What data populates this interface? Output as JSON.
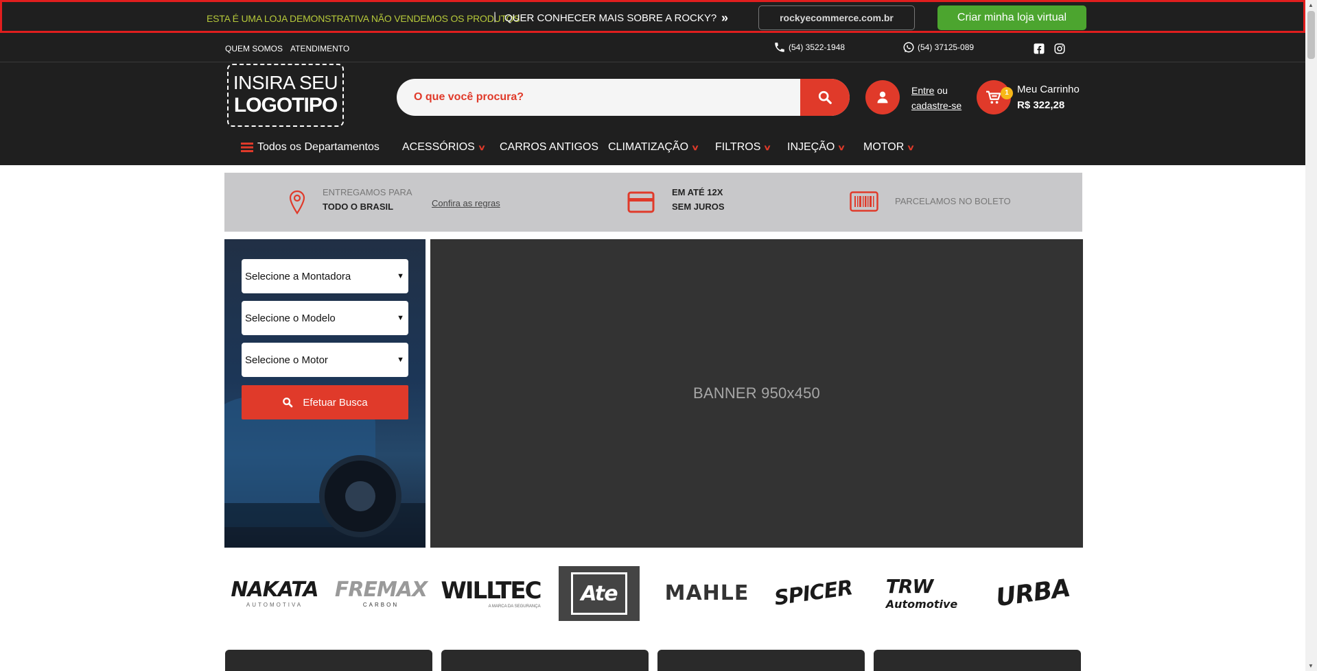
{
  "demo_bar": {
    "notice": "ESTA É UMA LOJA DEMONSTRATIVA NÃO VENDEMOS OS PRODUTOS",
    "separator": "|",
    "question": "QUER CONHECER MAIS SOBRE A ROCKY?",
    "arrows": "»",
    "url": "rockyecommerce.com.br",
    "cta": "Criar minha loja virtual"
  },
  "top_links": {
    "about": "QUEM SOMOS",
    "support": "ATENDIMENTO",
    "phone": "(54) 3522-1948",
    "whatsapp": "(54) 37125-089"
  },
  "logo": {
    "line1": "INSIRA SEU",
    "line2": "LOGOTIPO"
  },
  "search": {
    "placeholder": "O que você procura?"
  },
  "account": {
    "login": "Entre",
    "or": "ou",
    "register": "cadastre-se"
  },
  "cart": {
    "badge": "1",
    "label": "Meu Carrinho",
    "total": "R$ 322,28"
  },
  "nav": {
    "all_departments": "Todos os Departamentos",
    "items": [
      {
        "label": "ACESSÓRIOS"
      },
      {
        "label": "CARROS ANTIGOS"
      },
      {
        "label": "CLIMATIZAÇÃO"
      },
      {
        "label": "FILTROS"
      },
      {
        "label": "INJEÇÃO"
      },
      {
        "label": "MOTOR"
      }
    ]
  },
  "info": {
    "delivery_top": "ENTREGAMOS PARA",
    "delivery_bottom": "TODO O BRASIL",
    "rules_link": "Confira as regras",
    "installments_top": "EM ATÉ 12X",
    "installments_bottom": "SEM JUROS",
    "boleto": "PARCELAMOS NO BOLETO"
  },
  "vehicle_search": {
    "brand_select": "Selecione a Montadora",
    "model_select": "Selecione o Modelo",
    "engine_select": "Selecione o Motor",
    "button": "Efetuar Busca"
  },
  "banner": {
    "label": "BANNER 950x450"
  },
  "brands": [
    {
      "name": "NAKATA",
      "sub": "AUTOMOTIVA"
    },
    {
      "name": "FREMAX",
      "sub": "CARBON"
    },
    {
      "name": "WILLTEC",
      "sub": "A MARCA DA SEGURANÇA"
    },
    {
      "name": "Ate"
    },
    {
      "name": "MAHLE"
    },
    {
      "name": "SPICER"
    },
    {
      "name": "TRW",
      "sub": "Automotive"
    },
    {
      "name": "URBA"
    }
  ],
  "colors": {
    "accent": "#e03a2a",
    "dark": "#1f1f1f",
    "cta_green": "#4ca52f",
    "badge": "#f7b718"
  }
}
